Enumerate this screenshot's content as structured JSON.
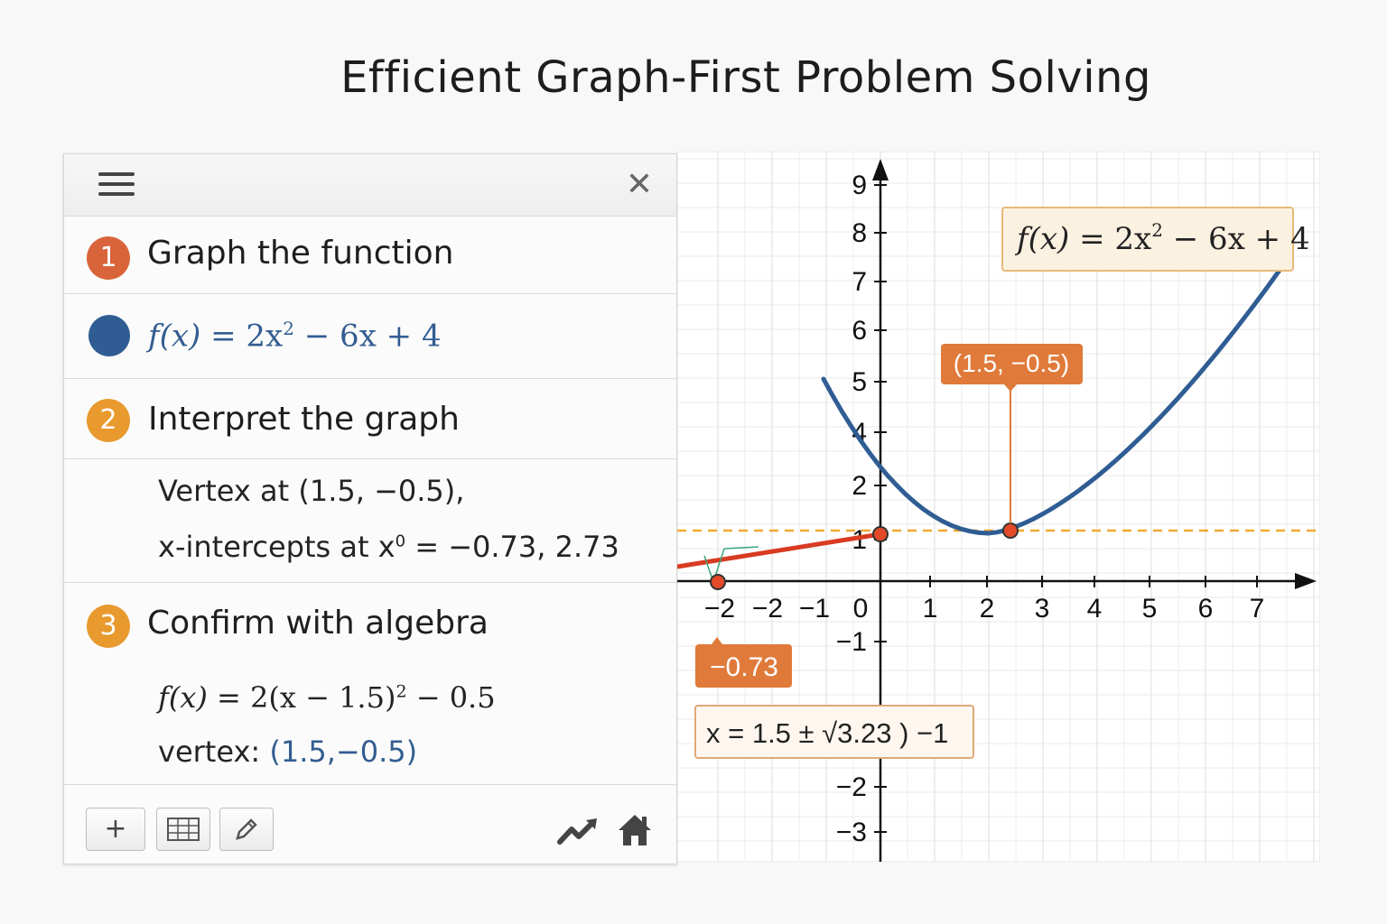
{
  "title": "Efficient Graph-First Problem Solving",
  "panel": {
    "steps": [
      {
        "num": "1",
        "label": "Graph the function",
        "color": "#d9643a"
      },
      {
        "num": "2",
        "label": "Interpret the graph",
        "color": "#e89a2e"
      },
      {
        "num": "3",
        "label": "Confirm with algebra",
        "color": "#e89a2e"
      }
    ],
    "expression": {
      "fx": "f(x)",
      "eq": " = 2x",
      "sup": "2",
      "rest": " − 6x + 4",
      "dot_color": "#2f5d93"
    },
    "interpret": {
      "line1": "Vertex at (1.5, −0.5),",
      "line2_a": "x-intercepts at x",
      "line2_sup": "0",
      "line2_b": " = −0.73, 2.73"
    },
    "confirm": {
      "eq_fx": "f(x)",
      "eq_rest": " = 2(x − 1.5)",
      "eq_sup": "2",
      "eq_tail": " − 0.5",
      "vertex_label": "vertex: ",
      "vertex_value": "(1.5,−0.5)"
    },
    "toolbar": {
      "add_icon": "+",
      "table_icon": "table-icon",
      "edit_icon": "pencil-icon",
      "graph_icon": "trend-icon",
      "home_icon": "home-icon"
    }
  },
  "graph": {
    "x_ticks": [
      "−2",
      "−2",
      "−1",
      "0",
      "1",
      "2",
      "3",
      "4",
      "5",
      "6",
      "7"
    ],
    "y_ticks": [
      "9",
      "8",
      "7",
      "6",
      "5",
      "4",
      "2",
      "1",
      "−1",
      "−2",
      "−3"
    ],
    "callout_formula": {
      "fx": "f(x)",
      "eq": " = 2x",
      "sup": "2",
      "rest": " − 6x + 4"
    },
    "vertex_callout": "(1.5, −0.5)",
    "intercept_callout": "−0.73",
    "solution_callout": "x = 1.5 ± √3.23 ) −1",
    "curve_color": "#2f5d93",
    "accent_color": "#e07a3a",
    "dashed_color": "#f0a830",
    "red_line_color": "#d83a22"
  }
}
